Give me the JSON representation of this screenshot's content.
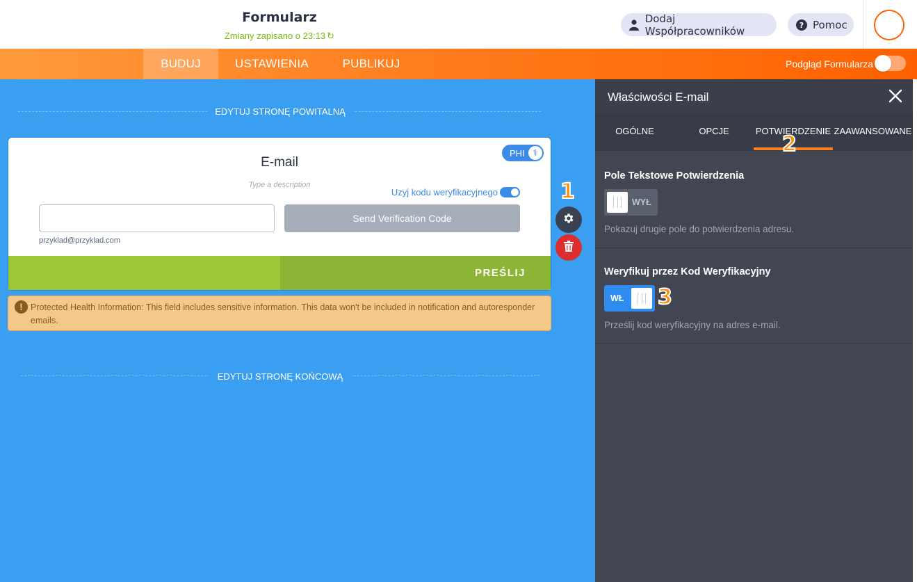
{
  "header": {
    "title": "Formularz",
    "saved_status": "Zmiany zapisano o 23:13",
    "collaborators_button": "Dodaj Współpracowników",
    "help_button": "Pomoc"
  },
  "nav": {
    "tabs": [
      {
        "label": "BUDUJ",
        "active": true
      },
      {
        "label": "USTAWIENIA",
        "active": false
      },
      {
        "label": "PUBLIKUJ",
        "active": false
      }
    ],
    "preview_label": "Podgląd Formularza",
    "preview_enabled": false
  },
  "canvas": {
    "welcome_page_label": "EDYTUJ STRONĘ POWITALNĄ",
    "end_page_label": "EDYTUJ STRONĘ KOŃCOWĄ",
    "field": {
      "label": "E-mail",
      "description_placeholder": "Type a description",
      "verification_toggle_label": "Uzyj kodu weryfikacyjnego",
      "verification_enabled": true,
      "input_value": "",
      "sublabel": "przyklad@przyklad.com",
      "send_code_button": "Send Verification Code",
      "phi_badge": "PHI"
    },
    "submit_button": "PREŚLIJ",
    "callout_1": "1",
    "phi_warning": "Protected Health Information: This field includes sensitive information. This data won't be included in notification and autoresponder emails."
  },
  "panel": {
    "title": "Właściwości E-mail",
    "tabs": [
      {
        "label": "OGÓLNE",
        "active": false
      },
      {
        "label": "OPCJE",
        "active": false
      },
      {
        "label": "POTWIERDZENIE",
        "active": true
      },
      {
        "label": "ZAAWANSOWANE",
        "active": false
      }
    ],
    "callout_2": "2",
    "confirm_field": {
      "title": "Pole Tekstowe Potwierdzenia",
      "toggle_label": "WYŁ",
      "enabled": false,
      "description": "Pokazuj drugie pole do potwierdzenia adresu."
    },
    "verify_code": {
      "title": "Weryfikuj przez Kod Weryfikacyjny",
      "toggle_label": "WŁ",
      "enabled": true,
      "description": "Prześlij kod weryfikacyjny na adres e-mail."
    },
    "callout_3": "3"
  },
  "colors": {
    "accent_orange": "#ff6100",
    "canvas_blue": "#3b9ff1",
    "panel_dark": "#414652",
    "submit_green": "#9ec839",
    "toggle_blue": "#2e8cf0"
  },
  "icons": [
    "refresh-icon",
    "user-icon",
    "question-icon",
    "close-icon",
    "gear-icon",
    "trash-icon",
    "caduceus-icon",
    "warning-icon"
  ]
}
